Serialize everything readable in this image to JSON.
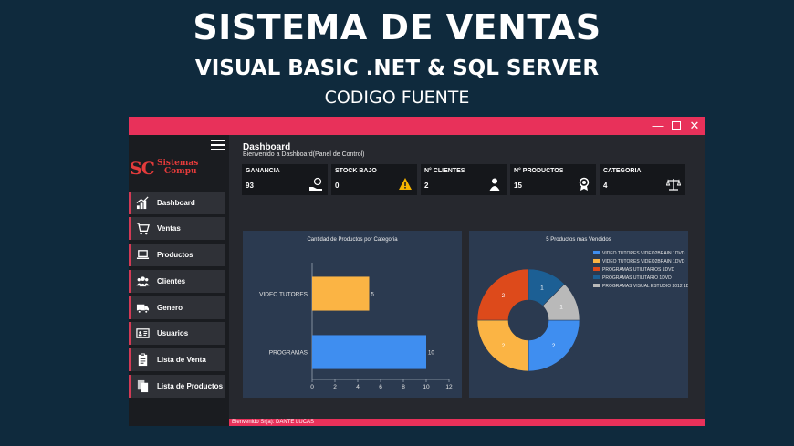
{
  "promo": {
    "title": "SISTEMA DE VENTAS",
    "subtitle": "VISUAL BASIC .NET & SQL SERVER",
    "code_label": "CODIGO FUENTE"
  },
  "window": {
    "controls": {
      "minimize": "—",
      "close": "✕"
    },
    "accent": "#e8315a"
  },
  "sidebar": {
    "logo": {
      "mark": "SC",
      "line1": "Sistemas",
      "line2": "Compu"
    },
    "items": [
      {
        "label": "Dashboard",
        "icon": "bar-chart-icon"
      },
      {
        "label": "Ventas",
        "icon": "cart-icon"
      },
      {
        "label": "Productos",
        "icon": "laptop-icon"
      },
      {
        "label": "Clientes",
        "icon": "users-icon"
      },
      {
        "label": "Genero",
        "icon": "truck-icon"
      },
      {
        "label": "Usuarios",
        "icon": "id-card-icon"
      },
      {
        "label": "Lista de Venta",
        "icon": "clipboard-icon"
      },
      {
        "label": "Lista de Productos",
        "icon": "documents-icon"
      }
    ]
  },
  "dashboard": {
    "title": "Dashboard",
    "subtitle": "Bienvenido a Dashboard(Panel de Control)",
    "stats": [
      {
        "label": "GANANCIA",
        "value": "93",
        "icon": "money-hand-icon"
      },
      {
        "label": "STOCK BAJO",
        "value": "0",
        "icon": "warning-icon"
      },
      {
        "label": "N° CLIENTES",
        "value": "2",
        "icon": "person-icon"
      },
      {
        "label": "N° PRODUCTOS",
        "value": "15",
        "icon": "badge-icon"
      },
      {
        "label": "CATEGORIA",
        "value": "4",
        "icon": "scale-icon"
      }
    ]
  },
  "status": {
    "text": "Bienvenido Sr(a):   DANTE LUCAS"
  },
  "chart_data": [
    {
      "type": "bar",
      "orientation": "horizontal",
      "title": "Cantidad de Productos por Categoria",
      "categories": [
        "VIDEO TUTORES",
        "PROGRAMAS"
      ],
      "values": [
        5,
        10
      ],
      "colors": [
        "#fbb444",
        "#3f8ef0"
      ],
      "xlim": [
        0,
        12
      ],
      "xticks": [
        "0",
        "2",
        "4",
        "6",
        "8",
        "10",
        "12"
      ],
      "grid": false,
      "data_labels": true
    },
    {
      "type": "pie",
      "donut": true,
      "title": "5 Productos mas Vendidos",
      "legend_position": "right",
      "slices": [
        {
          "label": "VIDEO TUTORES VIDEO2BRAIN 1DVD",
          "value": 2,
          "color": "#3f8ef0"
        },
        {
          "label": "VIDEO TUTORES VIDEO2BRAIN 1DVD",
          "value": 2,
          "color": "#fbb444"
        },
        {
          "label": "PROGRAMAS UTILITARIOS 1DVD",
          "value": 2,
          "color": "#dd4a1b"
        },
        {
          "label": "PROGRAMAS UTILITARIO 1DVD",
          "value": 1,
          "color": "#1c5f94"
        },
        {
          "label": "PROGRAMAS VISUAL ESTUDIO 2012 1DVD",
          "value": 1,
          "color": "#b9b9b9"
        }
      ]
    }
  ]
}
